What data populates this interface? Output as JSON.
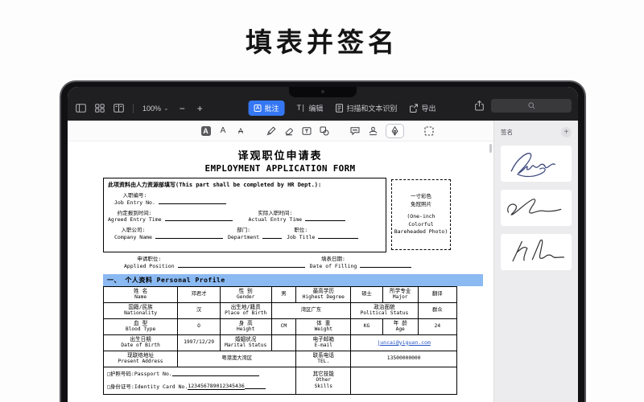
{
  "banner": {
    "title": "填表并签名"
  },
  "toolbar": {
    "zoom_level": "100%",
    "tabs": {
      "annotate": "批注",
      "annotate_glyph": "A",
      "edit": "编辑",
      "edit_cursor": "T|",
      "scan": "扫描和文本识别",
      "export": "导出"
    }
  },
  "icons": {
    "zoom_chevron": "⌄",
    "zoom_out": "−",
    "zoom_in": "+",
    "sidebar_add": "+"
  },
  "annotation_bar": {
    "highlight": "A",
    "underline": "A",
    "strikethrough": "A"
  },
  "sidebar": {
    "title": "签名"
  },
  "colors": {
    "accent_blue": "#3577f3",
    "section_bar_blue": "#8bb9f1",
    "email_link_blue": "#2553c4",
    "signature_ink_1": "#3e4a7e",
    "signature_ink_2": "#38383c",
    "signature_ink_3": "#303034"
  },
  "form": {
    "title_cn": "译观职位申请表",
    "title_en": "EMPLOYMENT APPLICATION FORM",
    "hr_header": "此项资料由人力资源部填写(This part shall be completed by HR Dept.):",
    "job_entry_cn": "入职编号:",
    "job_entry_en": "Job Entry No.",
    "agreed_cn": "约定报到时间:",
    "agreed_en": "Agreed Entry Time",
    "actual_cn": "实际入职时间:",
    "actual_en": "Actual Entry Time",
    "company_cn": "入职公司:",
    "company_en": "Company Name",
    "dept_cn": "部门:",
    "dept_en": "Department",
    "jobtitle_cn": "职位:",
    "jobtitle_en": "Job Title",
    "photo": {
      "cn1": "一寸彩色",
      "cn2": "免冠照片",
      "en1": "(One-inch",
      "en2": "Colorful",
      "en3": "Bareheaded Photo)"
    },
    "applied_cn": "申请职位:",
    "applied_en": "Applied Position",
    "filldate_cn": "填表日期:",
    "filldate_en": "Date of Filling",
    "section1": "一、 个人资料 Personal Profile",
    "profile": {
      "name": {
        "cn": "姓 名",
        "en": "Name",
        "value": "邓君才"
      },
      "gender": {
        "cn": "性 别",
        "en": "Gender",
        "value": "男"
      },
      "degree": {
        "cn": "最高学历",
        "en": "Highest Degree",
        "value": "硕士"
      },
      "major": {
        "cn": "所学专业",
        "en": "Major",
        "value": "翻译"
      },
      "nationality": {
        "cn": "国籍/民族",
        "en": "Nationality",
        "value": "汉"
      },
      "birthplace": {
        "cn": "出生地/籍贯",
        "en": "Place of Birth",
        "value": "湾区广东"
      },
      "political": {
        "cn": "政治面貌",
        "en": "Political Status",
        "value": "群众"
      },
      "blood": {
        "cn": "血 型",
        "en": "Blood Type",
        "value": "O"
      },
      "height": {
        "cn": "身 高",
        "en": "Height",
        "unit": "CM"
      },
      "weight": {
        "cn": "体 重",
        "en": "Weight",
        "unit": "KG"
      },
      "age": {
        "cn": "年 龄",
        "en": "Age",
        "value": "24"
      },
      "dob": {
        "cn": "出生日期",
        "en": "Date of Birth",
        "value": "1997/12/29"
      },
      "marital": {
        "cn": "婚姻状况",
        "en": "Marital Status"
      },
      "email": {
        "cn": "电子邮箱",
        "en": "E-mail",
        "value": "juncai@yiguan.com"
      },
      "address": {
        "cn": "现联络地址",
        "en": "Present Address",
        "value": "粤港澳大湾区"
      },
      "tel": {
        "cn": "联系电话",
        "en": "TEL.",
        "value": "13500000000"
      },
      "passport": {
        "label": "□护照号码:Passport No."
      },
      "idcard": {
        "label": "□身份证号:Identity Card No.",
        "value": "123456789012345436"
      },
      "skills": {
        "cn": "其它技能",
        "en1": "Other",
        "en2": "Skills"
      }
    }
  }
}
